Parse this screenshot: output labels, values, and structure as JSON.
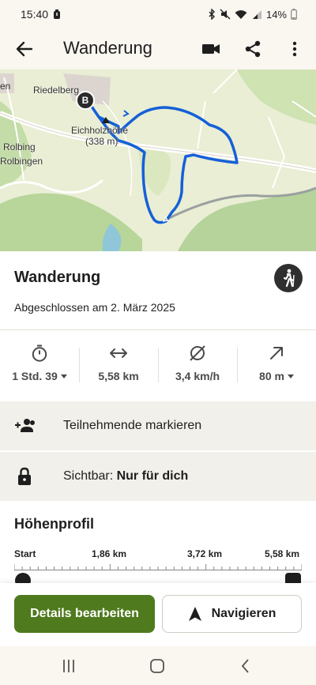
{
  "status_bar": {
    "time": "15:40",
    "battery": "14%",
    "icons": [
      "alarm-icon",
      "bluetooth-icon",
      "mute-icon",
      "wifi-icon",
      "signal-icon",
      "battery-icon"
    ]
  },
  "app_bar": {
    "title": "Wanderung",
    "actions": [
      "back-icon",
      "video-icon",
      "share-icon",
      "more-icon"
    ]
  },
  "map": {
    "labels": {
      "riedelberg": "Riedelberg",
      "eichholzhoehe": "Eichholzhöhe",
      "elevation": "(338 m)",
      "rolbing": "Rolbing",
      "rolbingen": "Rolbingen",
      "edge": "en"
    },
    "marker": "B",
    "route_color": "#1560d8"
  },
  "tour": {
    "title": "Wanderung",
    "subtitle": "Abgeschlossen am 2. März 2025",
    "sport_icon": "hiking-icon"
  },
  "stats": [
    {
      "icon": "stopwatch-icon",
      "value": "1 Std. 39",
      "dropdown": true
    },
    {
      "icon": "distance-arrows-icon",
      "value": "5,58 km",
      "dropdown": false
    },
    {
      "icon": "average-speed-icon",
      "value": "3,4 km/h",
      "dropdown": false
    },
    {
      "icon": "ascent-arrow-icon",
      "value": "80 m",
      "dropdown": true
    }
  ],
  "participants_row": {
    "label": "Teilnehmende markieren",
    "icon": "add-person-icon"
  },
  "visibility_row": {
    "label": "Sichtbar:",
    "value": "Nur für dich",
    "icon": "lock-icon"
  },
  "profile": {
    "title": "Höhenprofil",
    "km_labels": [
      "Start",
      "1,86 km",
      "3,72 km",
      "5,58 km"
    ]
  },
  "buttons": {
    "edit": "Details bearbeiten",
    "navigate": "Navigieren"
  },
  "colors": {
    "accent_green": "#4f7a1d",
    "row_background": "#f2f0ea",
    "header_background": "#faf6f0"
  }
}
